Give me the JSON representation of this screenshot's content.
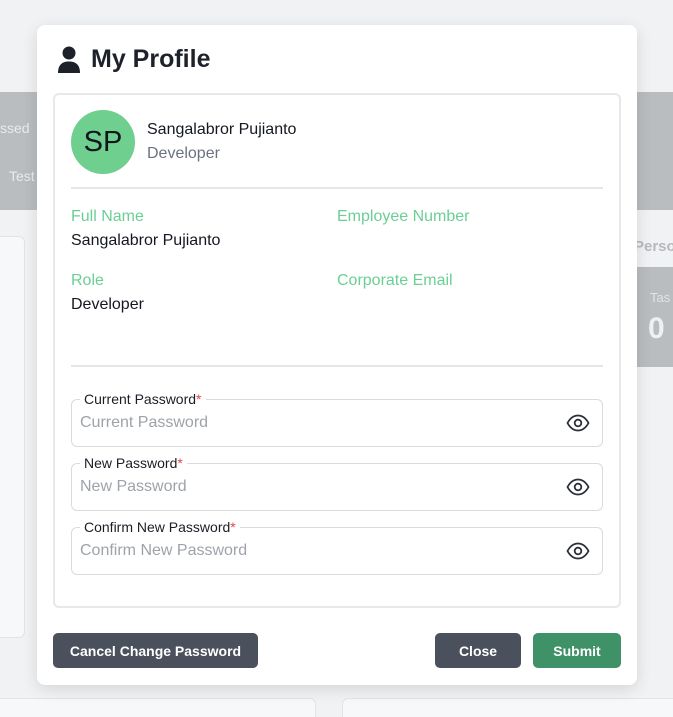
{
  "background": {
    "band_text_1": "ssed",
    "band_text_2": "Test",
    "side_heading": "Perso",
    "stat_label": "Tas",
    "stat_value": "0"
  },
  "modal": {
    "title": "My Profile",
    "title_icon": "user-icon"
  },
  "profile": {
    "initials": "SP",
    "name": "Sangalabror Pujianto",
    "role": "Developer",
    "avatar_color": "#6ecf8f"
  },
  "details": {
    "full_name_label": "Full Name",
    "full_name_value": "Sangalabror Pujianto",
    "employee_number_label": "Employee Number",
    "employee_number_value": "",
    "role_label": "Role",
    "role_value": "Developer",
    "corporate_email_label": "Corporate Email",
    "corporate_email_value": "",
    "label_color": "#6bcf94"
  },
  "password_form": {
    "current": {
      "label": "Current Password",
      "required_mark": "*",
      "placeholder": "Current Password",
      "value": ""
    },
    "new": {
      "label": "New Password",
      "required_mark": "*",
      "placeholder": "New Password",
      "value": ""
    },
    "confirm": {
      "label": "Confirm New Password",
      "required_mark": "*",
      "placeholder": "Confirm New Password",
      "value": ""
    },
    "toggle_icon": "eye-icon"
  },
  "actions": {
    "cancel_change_password": "Cancel Change Password",
    "close": "Close",
    "submit": "Submit",
    "submit_color": "#3f9167",
    "secondary_color": "#4a505c"
  }
}
